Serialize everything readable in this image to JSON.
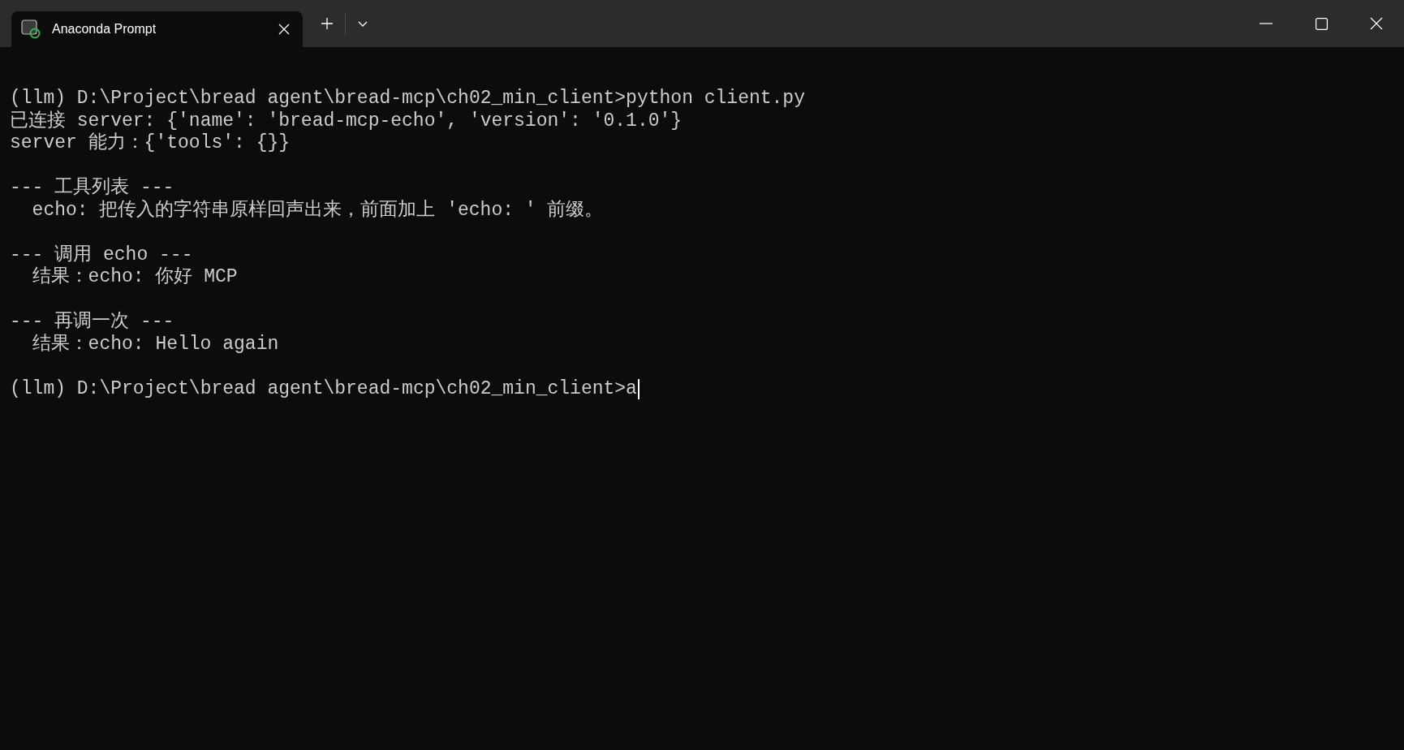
{
  "window": {
    "tab_title": "Anaconda Prompt"
  },
  "terminal": {
    "blocks": [
      {
        "lines": [
          {
            "text": "(llm) D:\\Project\\bread agent\\bread-mcp\\ch02_min_client>python client.py",
            "indented": false
          },
          {
            "text": "已连接 server: {'name': 'bread-mcp-echo', 'version': '0.1.0'}",
            "indented": false
          },
          {
            "text": "server 能力：{'tools': {}}",
            "indented": false
          }
        ]
      },
      {
        "lines": [
          {
            "text": "--- 工具列表 ---",
            "indented": false
          },
          {
            "text": "echo: 把传入的字符串原样回声出来，前面加上 'echo: ' 前缀。",
            "indented": true
          }
        ]
      },
      {
        "lines": [
          {
            "text": "--- 调用 echo ---",
            "indented": false
          },
          {
            "text": "结果：echo: 你好 MCP",
            "indented": true
          }
        ]
      },
      {
        "lines": [
          {
            "text": "--- 再调一次 ---",
            "indented": false
          },
          {
            "text": "结果：echo: Hello again",
            "indented": true
          }
        ]
      },
      {
        "lines": [
          {
            "text": "(llm) D:\\Project\\bread agent\\bread-mcp\\ch02_min_client>a",
            "indented": false
          }
        ]
      }
    ],
    "cursor": true
  }
}
